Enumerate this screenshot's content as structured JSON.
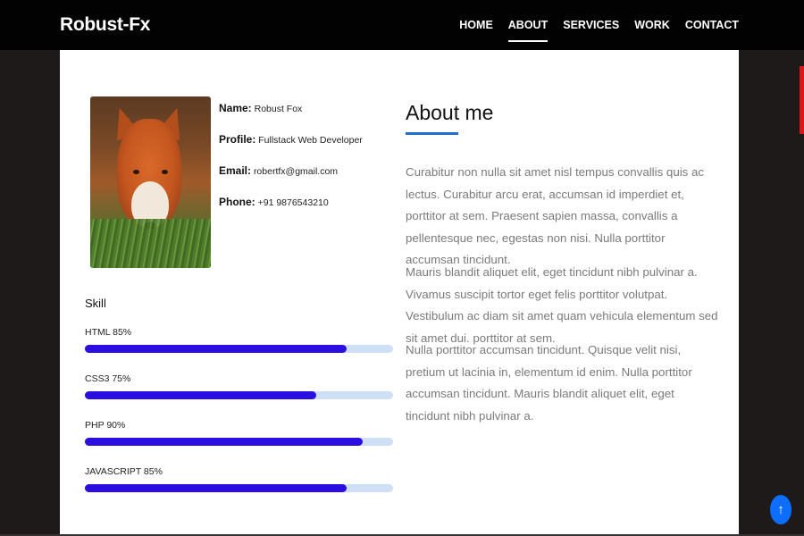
{
  "navbar": {
    "brand": "Robust-Fx",
    "links": [
      "HOME",
      "ABOUT",
      "SERVICES",
      "WORK",
      "CONTACT"
    ],
    "active": "ABOUT"
  },
  "profile": {
    "name_label": "Name:",
    "name_value": "Robust Fox",
    "profile_label": "Profile:",
    "profile_value": "Fullstack Web Developer",
    "email_label": "Email:",
    "email_value": "robertfx@gmail.com",
    "phone_label": "Phone:",
    "phone_value": "+91 9876543210"
  },
  "skills": {
    "title": "Skill",
    "items": [
      {
        "label": "HTML 85%",
        "percent": 85
      },
      {
        "label": "CSS3 75%",
        "percent": 75
      },
      {
        "label": "PHP 90%",
        "percent": 90
      },
      {
        "label": "JAVASCRIPT 85%",
        "percent": 85
      }
    ]
  },
  "about": {
    "title": "About me",
    "paragraphs": [
      "Curabitur non nulla sit amet nisl tempus convallis quis ac lectus. Curabitur arcu erat, accumsan id imperdiet et, porttitor at sem. Praesent sapien massa, convallis a pellentesque nec, egestas non nisi. Nulla porttitor accumsan tincidunt.",
      "Mauris blandit aliquet elit, eget tincidunt nibh pulvinar a. Vivamus suscipit tortor eget felis porttitor volutpat. Vestibulum ac diam sit amet quam vehicula elementum sed sit amet dui. porttitor at sem.",
      "Nulla porttitor accumsan tincidunt. Quisque velit nisi, pretium ut lacinia in, elementum id enim. Nulla porttitor accumsan tincidunt. Mauris blandit aliquet elit, eget tincidunt nibh pulvinar a."
    ]
  },
  "colors": {
    "skill_fill": "#2a0fe0",
    "skill_track": "#cfdff5",
    "accent": "#1f6fd6",
    "back_to_top": "#0d6efd"
  },
  "icons": {
    "back_to_top": "arrow-up-icon"
  }
}
